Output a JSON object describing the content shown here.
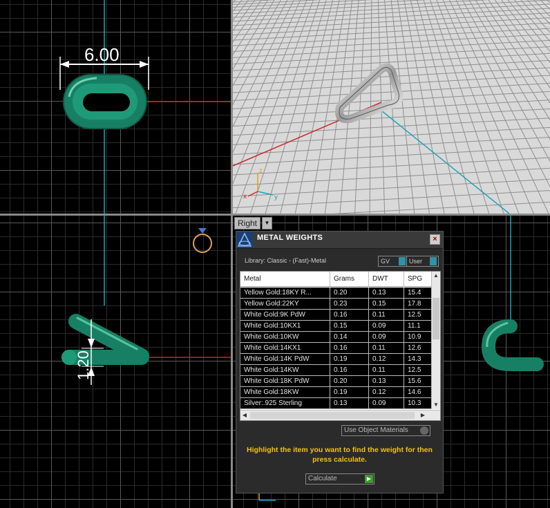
{
  "viewports": {
    "top": {
      "dimension_label": "6.00"
    },
    "perspective": {
      "axes": {
        "x": "x",
        "y": "y",
        "z": "z"
      }
    },
    "front": {
      "dimension_label": "1.20"
    },
    "right": {
      "label": "Right",
      "menu_arrow": "▼"
    }
  },
  "panel": {
    "title": "METAL WEIGHTS",
    "close_glyph": "×",
    "library_label": "Library: Classic - (Fast)-Metal",
    "gv_label": "GV",
    "user_label": "User",
    "columns": [
      "Metal",
      "Grams",
      "DWT",
      "SPG"
    ],
    "rows": [
      [
        "Yellow Gold:18KY R...",
        "0.20",
        "0.13",
        "15.4"
      ],
      [
        "Yellow Gold:22KY",
        "0.23",
        "0.15",
        "17.8"
      ],
      [
        "White Gold:9K PdW",
        "0.16",
        "0.11",
        "12.5"
      ],
      [
        "White Gold:10KX1",
        "0.15",
        "0.09",
        "11.1"
      ],
      [
        "White Gold:10KW",
        "0.14",
        "0.09",
        "10.9"
      ],
      [
        "White Gold:14KX1",
        "0.16",
        "0.11",
        "12.6"
      ],
      [
        "White Gold:14K PdW",
        "0.19",
        "0.12",
        "14.3"
      ],
      [
        "White Gold:14KW",
        "0.16",
        "0.11",
        "12.5"
      ],
      [
        "White Gold:18K PdW",
        "0.20",
        "0.13",
        "15.6"
      ],
      [
        "White Gold:18KW",
        "0.19",
        "0.12",
        "14.6"
      ],
      [
        "Silver:.925 Sterling",
        "0.13",
        "0.09",
        "10.3"
      ]
    ],
    "use_object_materials_label": "Use Object Materials",
    "hint": "Highlight the item you want to find the weight for then press calculate.",
    "calculate_label": "Calculate"
  },
  "colors": {
    "model_green": "#1a8a66",
    "axis_red": "#c62828",
    "axis_cyan": "#20a3b8",
    "hint_yellow": "#f2c500"
  }
}
